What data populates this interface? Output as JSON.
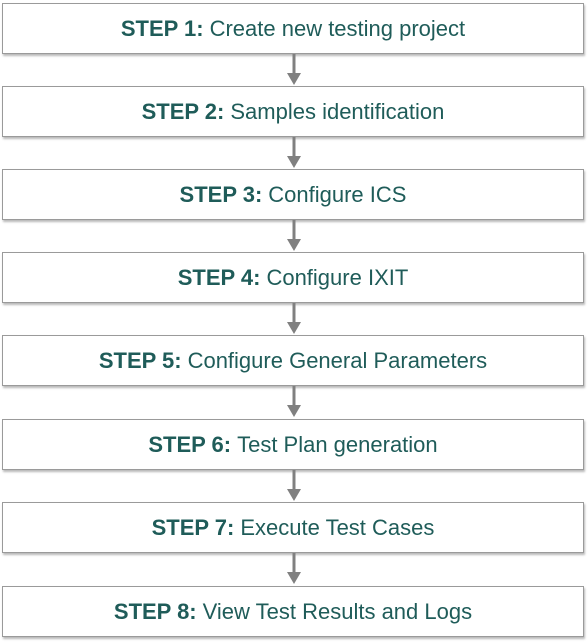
{
  "steps": [
    {
      "number": "STEP 1:",
      "text": "Create new testing project"
    },
    {
      "number": "STEP 2:",
      "text": "Samples identification"
    },
    {
      "number": "STEP 3:",
      "text": "Configure ICS"
    },
    {
      "number": "STEP 4:",
      "text": "Configure IXIT"
    },
    {
      "number": "STEP 5:",
      "text": "Configure General Parameters"
    },
    {
      "number": "STEP 6:",
      "text": "Test Plan generation"
    },
    {
      "number": "STEP 7:",
      "text": "Execute Test Cases"
    },
    {
      "number": "STEP 8:",
      "text": "View Test Results and Logs"
    }
  ],
  "colors": {
    "text": "#1f5c59",
    "border": "#9a9a9a",
    "arrow": "#808080"
  }
}
